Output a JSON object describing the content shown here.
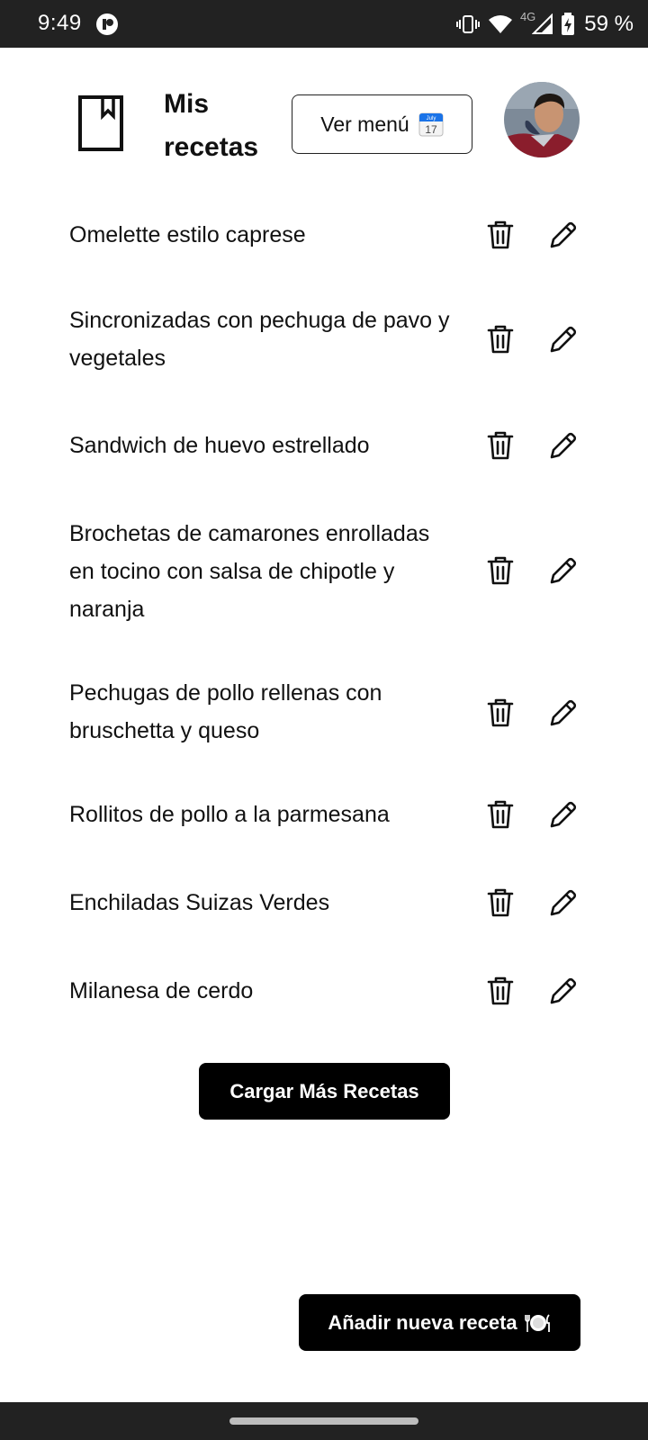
{
  "status_bar": {
    "time": "9:49",
    "network": "4G",
    "battery": "59 %",
    "icons": [
      "app-notification-icon",
      "vibrate-icon",
      "wifi-icon",
      "signal-icon",
      "battery-charging-icon"
    ]
  },
  "header": {
    "title": "Mis recetas",
    "title_icon": "bookmark-icon",
    "menu_button_label": "Ver menú",
    "menu_button_icon": "calendar-icon",
    "calendar_month": "July",
    "calendar_day": "17",
    "avatar": "user-avatar"
  },
  "recipes": [
    {
      "name": "Omelette estilo caprese"
    },
    {
      "name": "Sincronizadas con pechuga de pavo y vegetales"
    },
    {
      "name": "Sandwich de huevo estrellado"
    },
    {
      "name": "Brochetas de camarones enrolladas en tocino con salsa de chipotle y naranja"
    },
    {
      "name": "Pechugas de pollo rellenas con bruschetta y queso"
    },
    {
      "name": "Rollitos de pollo a la parmesana"
    },
    {
      "name": "Enchiladas Suizas Verdes"
    },
    {
      "name": "Milanesa de cerdo"
    }
  ],
  "actions": {
    "load_more_label": "Cargar Más Recetas",
    "add_recipe_label": "Añadir nueva receta",
    "add_recipe_icon": "plate-cutlery-icon"
  },
  "colors": {
    "status_bar": "#222222",
    "primary_button": "#000000",
    "text": "#111111",
    "calendar_accent": "#1a73e8"
  }
}
